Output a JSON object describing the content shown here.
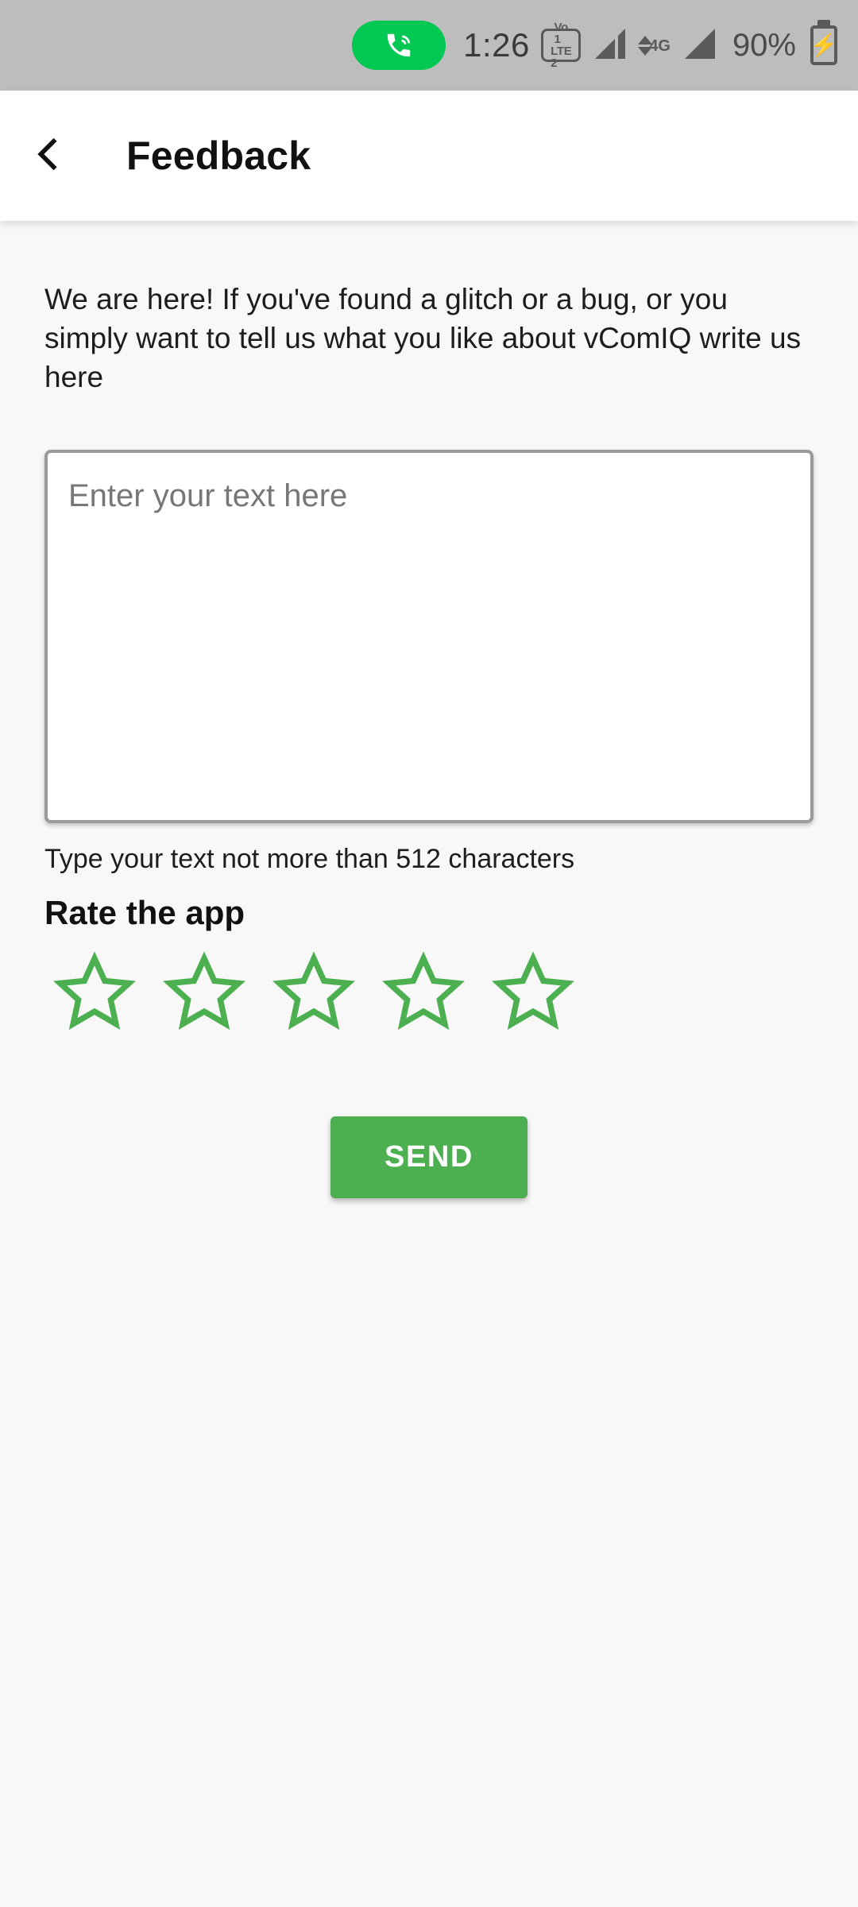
{
  "status_bar": {
    "call_icon": "phone-in-call-icon",
    "time": "1:26",
    "volte_top": "Vo",
    "volte_sim_top": "1",
    "volte_bottom": "LTE",
    "volte_sim_bottom": "2",
    "network_type": "4G",
    "battery_percent": "90%",
    "battery_state": "charging",
    "pill_color": "#00c853",
    "bar_color": "#bdbdbd"
  },
  "app_bar": {
    "back_icon": "chevron-left-icon",
    "title": "Feedback"
  },
  "main": {
    "intro_text": "We are here! If you've found a glitch or a bug, or you simply want to tell us what you like about vComIQ write us here",
    "feedback_input": {
      "placeholder": "Enter your text here",
      "value": ""
    },
    "helper_text": "Type your text not more than 512 characters",
    "rate_title": "Rate the app",
    "rating": {
      "value": 0,
      "max": 5,
      "star_color": "#4caf50",
      "stars": [
        {
          "index": 1,
          "filled": false
        },
        {
          "index": 2,
          "filled": false
        },
        {
          "index": 3,
          "filled": false
        },
        {
          "index": 4,
          "filled": false
        },
        {
          "index": 5,
          "filled": false
        }
      ]
    },
    "send_label": "SEND",
    "send_color": "#4caf50"
  }
}
